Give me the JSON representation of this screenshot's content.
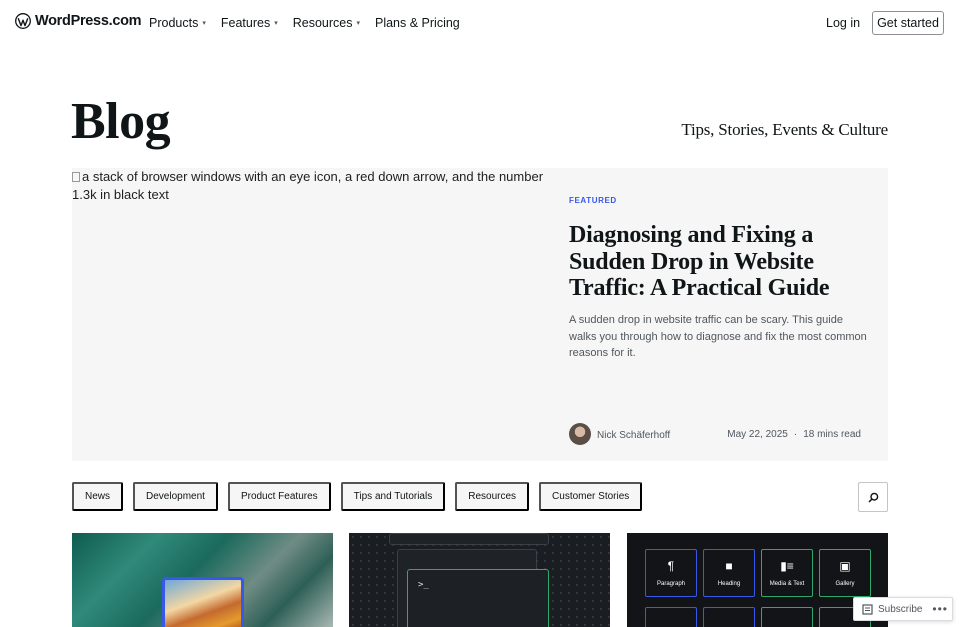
{
  "header": {
    "logo_text": "WordPress.com",
    "menu": [
      {
        "label": "Products",
        "has_caret": true
      },
      {
        "label": "Features",
        "has_caret": true
      },
      {
        "label": "Resources",
        "has_caret": true
      },
      {
        "label": "Plans & Pricing",
        "has_caret": false
      }
    ],
    "caret_glyph": "▾",
    "login_label": "Log in",
    "get_started_label": "Get started"
  },
  "page": {
    "title": "Blog",
    "tagline": "Tips, Stories, Events & Culture"
  },
  "featured": {
    "image_alt": "a stack of browser windows with an eye icon, a red down arrow, and the number 1.3k in black text",
    "label": "FEATURED",
    "title": "Diagnosing and Fixing a Sudden Drop in Website Traffic: A Practical Guide",
    "excerpt": "A sudden drop in website traffic can be scary. This guide walks you through how to diagnose and fix the most common reasons for it.",
    "author": "Nick Schäferhoff",
    "date": "May 22, 2025",
    "separator": "·",
    "read_time": "18 mins read"
  },
  "categories": [
    "News",
    "Development",
    "Product Features",
    "Tips and Tutorials",
    "Resources",
    "Customer Stories"
  ],
  "cards": {
    "terminal_prompt": ">_",
    "blocks": [
      {
        "glyph": "¶",
        "label": "Paragraph"
      },
      {
        "glyph": "■",
        "label": "Heading"
      },
      {
        "glyph": "▮≡",
        "label": "Media & Text"
      },
      {
        "glyph": "▣",
        "label": "Gallery"
      }
    ]
  },
  "subscribe": {
    "label": "Subscribe",
    "more": "•••"
  },
  "colors": {
    "accent": "#3858e9",
    "text": "#101517",
    "muted": "#50575e",
    "card_bg": "#f6f6f6",
    "green": "#2fa86b"
  }
}
